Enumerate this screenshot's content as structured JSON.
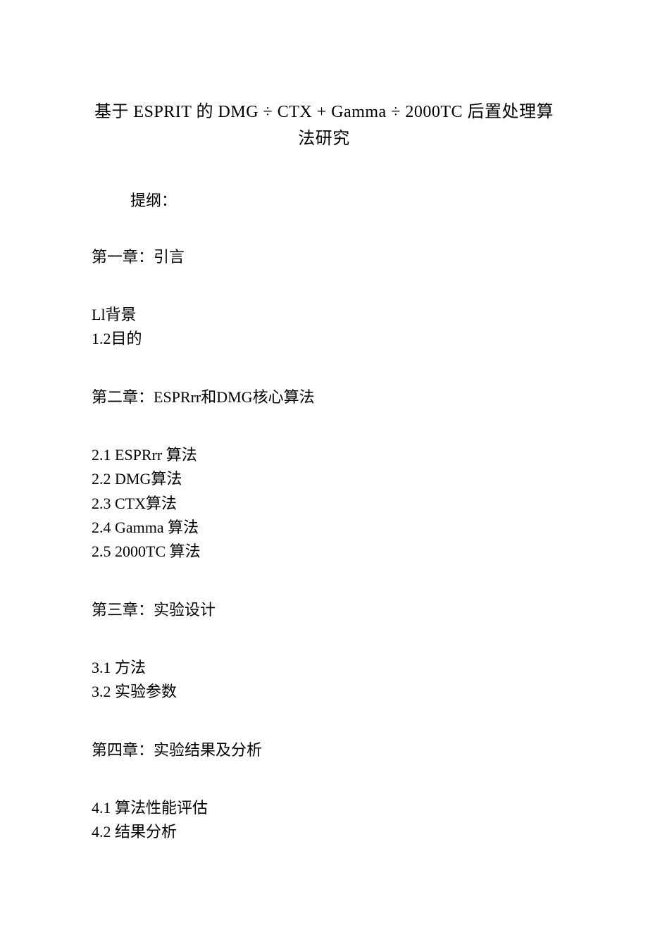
{
  "title": {
    "line1": "基于 ESPRIT 的 DMG ÷ CTX + Gamma ÷ 2000TC 后置处理算",
    "line2": "法研究"
  },
  "outline_label": "提纲：",
  "chapters": [
    {
      "heading": "第一章：引言",
      "items": [
        "Ll背景",
        "1.2目的"
      ]
    },
    {
      "heading": "第二章：ESPRrr和DMG核心算法",
      "items": [
        "2.1  ESPRrr 算法",
        "2.2  DMG算法",
        "2.3  CTX算法",
        "2.4  Gamma 算法",
        "2.5  2000TC 算法"
      ]
    },
    {
      "heading": "第三章：实验设计",
      "items": [
        "3.1  方法",
        "3.2  实验参数"
      ]
    },
    {
      "heading": "第四章：实验结果及分析",
      "items": [
        "4.1  算法性能评估",
        "4.2  结果分析"
      ]
    }
  ]
}
